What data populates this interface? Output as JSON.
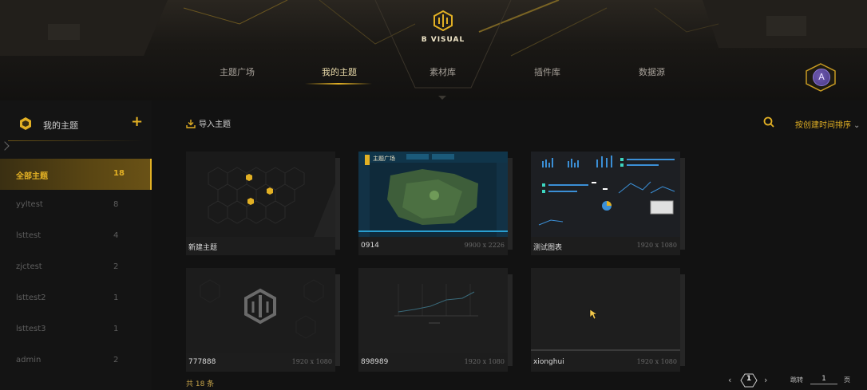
{
  "brand": {
    "name": "B VISUAL",
    "logo_icon": "hexagon-logo-icon"
  },
  "nav": {
    "tabs": [
      {
        "label": "主题广场"
      },
      {
        "label": "我的主题",
        "active": true
      },
      {
        "label": "素材库"
      },
      {
        "label": "插件库"
      },
      {
        "label": "数据源"
      }
    ]
  },
  "user": {
    "avatar_letter": "A"
  },
  "sidebar": {
    "title": "我的主题",
    "add_label": "+",
    "items": [
      {
        "name": "全部主题",
        "count": "18",
        "active": true
      },
      {
        "name": "yyltest",
        "count": "8"
      },
      {
        "name": "lsttest",
        "count": "4"
      },
      {
        "name": "zjctest",
        "count": "2"
      },
      {
        "name": "lsttest2",
        "count": "1"
      },
      {
        "name": "lsttest3",
        "count": "1"
      },
      {
        "name": "admin",
        "count": "2"
      }
    ]
  },
  "toolbar": {
    "import_label": "导入主题",
    "sort_label": "按创建时间排序",
    "chevron": "⌄"
  },
  "cards": [
    {
      "title": "新建主题",
      "size": "",
      "thumb": "new"
    },
    {
      "title": "0914",
      "size": "9900 x 2226",
      "thumb": "map",
      "badge": "主题广场"
    },
    {
      "title": "测试图表",
      "size": "1920 x 1080",
      "thumb": "dashboard"
    },
    {
      "title": "777888",
      "size": "1920 x 1080",
      "thumb": "logo"
    },
    {
      "title": "898989",
      "size": "1920 x 1080",
      "thumb": "linechart"
    },
    {
      "title": "xionghui",
      "size": "1920 x 1080",
      "thumb": "blank"
    }
  ],
  "footer": {
    "total_label": "共 18 条",
    "prev": "‹",
    "next": "›",
    "current_page": "1",
    "jump_label": "跳转",
    "jump_value": "1",
    "page_word": "页"
  },
  "colors": {
    "accent": "#e2b024",
    "background": "#121212",
    "avatar": "#5b49a0"
  }
}
